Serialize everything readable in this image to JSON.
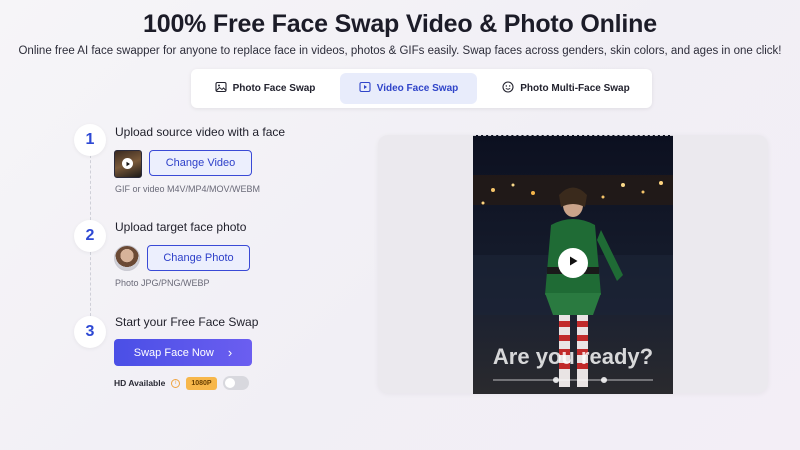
{
  "header": {
    "title": "100% Free Face Swap Video & Photo Online",
    "subtitle": "Online free AI face swapper for anyone to replace face in videos, photos & GIFs easily. Swap faces across genders, skin colors, and ages in one click!"
  },
  "tabs": [
    {
      "label": "Photo Face Swap",
      "icon": "image-icon",
      "active": false
    },
    {
      "label": "Video Face Swap",
      "icon": "video-icon",
      "active": true
    },
    {
      "label": "Photo Multi-Face Swap",
      "icon": "multi-face-icon",
      "active": false
    }
  ],
  "steps": [
    {
      "number": "1",
      "title": "Upload source video with a face",
      "button": "Change Video",
      "hint": "GIF or video M4V/MP4/MOV/WEBM"
    },
    {
      "number": "2",
      "title": "Upload target face photo",
      "button": "Change Photo",
      "hint": "Photo JPG/PNG/WEBP"
    },
    {
      "number": "3",
      "title": "Start your Free Face Swap",
      "button": "Swap Face Now"
    }
  ],
  "hd": {
    "label": "HD Available",
    "badge": "1080P",
    "enabled": false
  },
  "preview": {
    "caption": "Are you ready?"
  },
  "colors": {
    "accent": "#2e49d4",
    "primary_button": "#4a4fe6",
    "badge": "#f7b74b"
  }
}
